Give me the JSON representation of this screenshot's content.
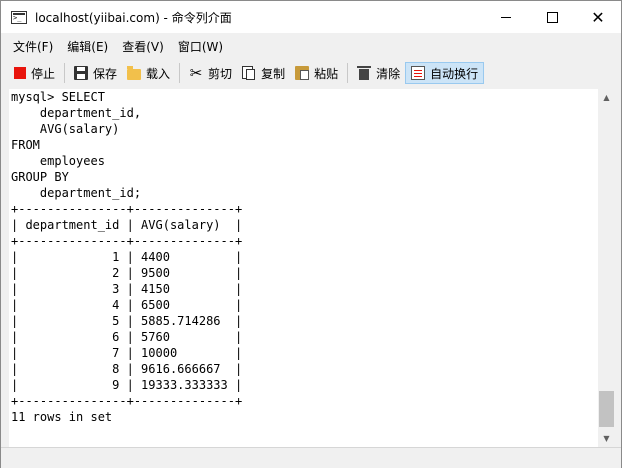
{
  "window": {
    "title": "localhost(yiibai.com) - 命令列介面",
    "minimize_glyph": "",
    "close_glyph": "✕"
  },
  "menu": [
    {
      "label": "文件(F)"
    },
    {
      "label": "编辑(E)"
    },
    {
      "label": "查看(V)"
    },
    {
      "label": "窗口(W)"
    }
  ],
  "toolbar": {
    "stop": "停止",
    "save": "保存",
    "load": "载入",
    "cut": "剪切",
    "copy": "复制",
    "paste": "粘贴",
    "clear": "清除",
    "wrap": "自动换行"
  },
  "console": {
    "output": "mysql> SELECT\n    department_id,\n    AVG(salary)\nFROM\n    employees\nGROUP BY\n    department_id;\n+---------------+--------------+\n| department_id | AVG(salary)  |\n+---------------+--------------+\n|             1 | 4400         |\n|             2 | 9500         |\n|             3 | 4150         |\n|             4 | 6500         |\n|             5 | 5885.714286  |\n|             6 | 5760         |\n|             7 | 10000        |\n|             8 | 9616.666667  |\n|             9 | 19333.333333 |\n+---------------+--------------+\n11 rows in set"
  },
  "scrollbar": {
    "up_glyph": "▲",
    "down_glyph": "▼"
  }
}
